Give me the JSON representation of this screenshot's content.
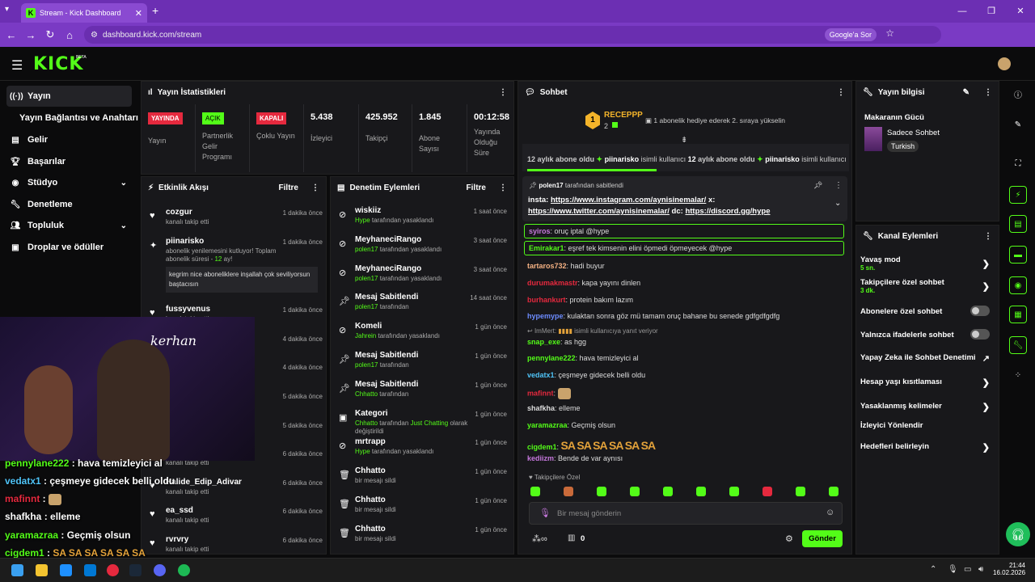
{
  "browser": {
    "tab_title": "Stream - Kick Dashboard",
    "url": "dashboard.kick.com/stream",
    "google_btn": "Google'a Sor"
  },
  "header": {
    "logo": "KICK",
    "beta": "BETA"
  },
  "sidebar": {
    "items": [
      {
        "label": "Yayın",
        "icon": "broadcast-icon",
        "active": true
      },
      {
        "label": "Yayın Bağlantısı ve Anahtarı",
        "icon": ""
      },
      {
        "label": "Gelir",
        "icon": "revenue-icon"
      },
      {
        "label": "Başarılar",
        "icon": "trophy-icon"
      },
      {
        "label": "Stüdyo",
        "icon": "studio-icon",
        "chevron": true
      },
      {
        "label": "Denetleme",
        "icon": "wrench-icon"
      },
      {
        "label": "Topluluk",
        "icon": "community-icon",
        "chevron": true
      },
      {
        "label": "Droplar ve ödüller",
        "icon": "gift-icon"
      }
    ]
  },
  "stats": {
    "title": "Yayın İstatistikleri",
    "items": [
      {
        "badge": "YAYINDA",
        "badge_color": "#e5293e",
        "label": "Yayın"
      },
      {
        "badge": "AÇIK",
        "badge_color": "#53fc18",
        "label": "Partnerlik Gelir Programı"
      },
      {
        "badge": "KAPALI",
        "badge_color": "#e5293e",
        "label": "Çoklu Yayın"
      },
      {
        "value": "5.438",
        "label": "İzleyici"
      },
      {
        "value": "425.952",
        "label": "Takipçi"
      },
      {
        "value": "1.845",
        "label": "Abone Sayısı"
      },
      {
        "value": "00:12:58",
        "label": "Yayında Olduğu Süre"
      }
    ]
  },
  "activity": {
    "title": "Etkinlik Akışı",
    "filter": "Filtre",
    "items": [
      {
        "name": "cozgur",
        "sub": "kanalı takip etti",
        "time": "1 dakika önce"
      },
      {
        "name": "piinarisko",
        "sub": "abonelik yenilemesini kutluyor! Toplam abonelik süresi - ",
        "sub_hl": "12",
        "sub_end": " ay!",
        "time": "1 dakika önce",
        "msg": "kegrim nice aboneliklere inşallah çok seviliyorsun baştacısın"
      },
      {
        "name": "fussyvenus",
        "sub": "kanalı takip etti",
        "time": "1 dakika önce"
      },
      {
        "name": "",
        "sub": "",
        "time": "4 dakika önce"
      },
      {
        "name": "",
        "sub": "",
        "time": "4 dakika önce"
      },
      {
        "name": "",
        "sub": "",
        "time": "5 dakika önce"
      },
      {
        "name": "",
        "sub": "",
        "time": "5 dakika önce"
      },
      {
        "name": "",
        "sub": "kanalı takip etti",
        "time": "6 dakika önce"
      },
      {
        "name": "Halide_Edip_Adivar",
        "sub": "kanalı takip etti",
        "time": "6 dakika önce"
      },
      {
        "name": "ea_ssd",
        "sub": "kanalı takip etti",
        "time": "6 dakika önce"
      },
      {
        "name": "rvrvry",
        "sub": "kanalı takip etti",
        "time": "6 dakika önce"
      }
    ]
  },
  "moderation": {
    "title": "Denetim Eylemleri",
    "filter": "Filtre",
    "items": [
      {
        "name": "wiskiiz",
        "by": "Hype",
        "action": " tarafından yasaklandı",
        "time": "1 saat önce",
        "icon": "ban-icon"
      },
      {
        "name": "MeyhaneciRango",
        "by": "polen17",
        "action": " tarafından yasaklandı",
        "time": "3 saat önce",
        "icon": "ban-icon"
      },
      {
        "name": "MeyhaneciRango",
        "by": "polen17",
        "action": " tarafından yasaklandı",
        "time": "3 saat önce",
        "icon": "ban-icon"
      },
      {
        "name": "Mesaj Sabitlendi",
        "by": "polen17",
        "action": " tarafından",
        "time": "14 saat önce",
        "icon": "pin-icon"
      },
      {
        "name": "Komeli",
        "by": "Jahrein",
        "action": " tarafından yasaklandı",
        "time": "1 gün önce",
        "icon": "ban-icon"
      },
      {
        "name": "Mesaj Sabitlendi",
        "by": "polen17",
        "action": " tarafından",
        "time": "1 gün önce",
        "icon": "pin-icon"
      },
      {
        "name": "Mesaj Sabitlendi",
        "by": "Chhatto",
        "action": " tarafından",
        "time": "1 gün önce",
        "icon": "pin-icon"
      },
      {
        "name": "Kategori",
        "by": "Chhatto",
        "action": " tarafından ",
        "cat": "Just Chatting",
        "action2": " olarak değiştirildi",
        "time": "1 gün önce",
        "icon": "category-icon"
      },
      {
        "name": "mrtrapp",
        "by": "Hype",
        "action": " tarafından yasaklandı",
        "time": "1 gün önce",
        "icon": "ban-icon"
      },
      {
        "name": "Chhatto",
        "by": "",
        "action": "bir mesajı sildi",
        "time": "1 gün önce",
        "icon": "trash-icon"
      },
      {
        "name": "Chhatto",
        "by": "",
        "action": "bir mesajı sildi",
        "time": "1 gün önce",
        "icon": "trash-icon"
      },
      {
        "name": "Chhatto",
        "by": "",
        "action": "bir mesajı sildi",
        "time": "1 gün önce",
        "icon": "trash-icon"
      }
    ]
  },
  "chat": {
    "title": "Sohbet",
    "gifter": {
      "rank": "1",
      "name": "RECEPPP",
      "count": "2",
      "msg": "1 abonelik hediye ederek 2. sıraya yükselin"
    },
    "ticker": [
      {
        "t": "12 aylık abone oldu"
      },
      {
        "name": "piinarisko",
        "mid": " isimli kullanıcı ",
        "num": "12",
        "end": " aylık abone oldu"
      },
      {
        "name": "piinarisko",
        "mid": " isimli kullanıcı "
      }
    ],
    "pinned": {
      "by": "polen17",
      "by_tail": " tarafından sabitlendi",
      "l1a": "insta: ",
      "l1link": "https://www.instagram.com/aynisinemalar/",
      "l1b": " x:",
      "l2link": "https://www.twitter.com/aynisinemalar/",
      "l2b": " dc: ",
      "l2link2": "https://discord.gg/hype"
    },
    "messages": [
      {
        "user": "syiros",
        "color": "#c678dd",
        "text": "oruç iptal @hype",
        "highlight": true
      },
      {
        "user": "Emirakar1",
        "color": "#53fc18",
        "text": "eşref tek kimsenin elini öpmedi öpmeyecek @hype",
        "highlight": true
      },
      {
        "user": "tartaros732",
        "color": "#f4b183",
        "text": "hadi buyur"
      },
      {
        "user": "durumakmastr",
        "color": "#e5293e",
        "text": "kapa yayını dinlen"
      },
      {
        "user": "burhankurt",
        "color": "#e5293e",
        "text": "protein bakım lazım"
      },
      {
        "user": "hypemype",
        "color": "#6d8cff",
        "text": "kulaktan sonra göz mü tamam oruç bahane bu senede gdfgdfgdfg"
      },
      {
        "reply": "ImMert:",
        "reply_tail": " isimli kullanıcıya yanıt veriyor"
      },
      {
        "user": "snap_exe",
        "color": "#53fc18",
        "text": "as hgg"
      },
      {
        "user": "pennylane222",
        "color": "#53fc18",
        "text": "hava temizleyici al"
      },
      {
        "user": "vedatx1",
        "color": "#4fc3f7",
        "text": "çeşmeye gidecek belli oldu"
      },
      {
        "user": "mafinnt",
        "color": "#e5293e",
        "text": ""
      },
      {
        "user": "shafkha",
        "color": "#ddd",
        "text": "elleme"
      },
      {
        "user": "yaramazraa",
        "color": "#53fc18",
        "text": "Geçmiş olsun"
      },
      {
        "user": "cigdem1",
        "color": "#53fc18",
        "text": "SA SA SA SA SA SA"
      },
      {
        "user": "kediizm",
        "color": "#c678dd",
        "text": "Bende de var aynısı"
      }
    ],
    "followers_only": "Takipçilere Özel",
    "input_placeholder": "Bir mesaj gönderin",
    "count": "0",
    "send": "Gönder"
  },
  "stream_info": {
    "title": "Yayın bilgisi",
    "stream_title": "Makaranın Gücü",
    "category": "Sadece Sohbet",
    "tag": "Turkish"
  },
  "channel_actions": {
    "title": "Kanal Eylemleri",
    "items": [
      {
        "label": "Yavaş mod",
        "sub": "5 sn.",
        "type": "arrow"
      },
      {
        "label": "Takipçilere özel sohbet",
        "sub": "3 dk.",
        "type": "arrow"
      },
      {
        "label": "Abonelere özel sohbet",
        "type": "toggle"
      },
      {
        "label": "Yalnızca ifadelerle sohbet",
        "type": "toggle"
      },
      {
        "label": "Yapay Zeka ile Sohbet Denetimi",
        "type": "external"
      },
      {
        "label": "Hesap yaşı kısıtlaması",
        "type": "arrow"
      },
      {
        "label": "Yasaklanmış kelimeler",
        "type": "arrow"
      },
      {
        "label": "İzleyici Yönlendir",
        "type": "none"
      },
      {
        "label": "Hedefleri belirleyin",
        "type": "arrow"
      }
    ]
  },
  "overlay_chat": [
    {
      "user": "pennylane222",
      "sep": " : ",
      "text": "hava temizleyici al",
      "color": "#53fc18"
    },
    {
      "user": "vedatx1",
      "sep": " : ",
      "text": "çeşmeye gidecek belli oldu",
      "color": "#4fc3f7"
    },
    {
      "user": "mafinnt",
      "sep": " : ",
      "text": "",
      "color": "#e5293e"
    },
    {
      "user": "shafkha",
      "sep": " : ",
      "text": "elleme",
      "color": "#ffffff"
    },
    {
      "user": "yaramazraa",
      "sep": " : ",
      "text": "Geçmiş olsun",
      "color": "#53fc18"
    },
    {
      "user": "cigdem1",
      "sep": " : ",
      "text": "SA SA SA SA SA SA",
      "color": "#53fc18"
    }
  ],
  "taskbar": {
    "time": "21:44",
    "date": "16.02.2026"
  }
}
